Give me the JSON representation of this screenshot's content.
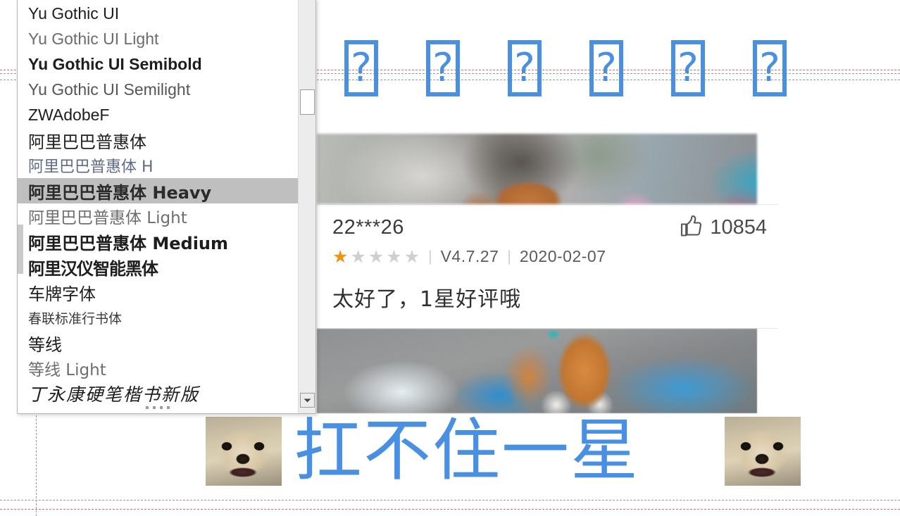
{
  "document": {
    "background_color": "#ffffff",
    "guides": {
      "red_dashed_color": "#e0654a",
      "gray_dashed_color": "#9a9a9a"
    }
  },
  "slide": {
    "tofu_row": {
      "glyph": "?",
      "count": 6,
      "color": "#4a90e2",
      "description": "missing-glyph-placeholder-boxes"
    },
    "big_text": "扛不住一星",
    "big_text_color": "#4a90e2",
    "memes": {
      "left_alt": "chihuahua-meme-face",
      "right_alt": "chihuahua-meme-face"
    },
    "review": {
      "photo_top_alt": "blurred-street-scene-with-cat-ears",
      "photo_bottom_alt": "orange-cat-sitting-on-blue-cloth-with-plastic-container",
      "reviewer": "22***26",
      "like_icon": "thumbs-up-icon",
      "like_count": "10854",
      "rating": 1,
      "rating_max": 5,
      "star_filled_color": "#f29211",
      "star_empty_color": "#cfcfcf",
      "version": "V4.7.27",
      "date": "2020-02-07",
      "separator": "|",
      "comment": "太好了，1星好评哦"
    }
  },
  "font_dropdown": {
    "selected": "阿里巴巴普惠体 Heavy",
    "scrollbar": {
      "down_arrow_icon": "chevron-down-icon"
    },
    "items": [
      {
        "label": "Yu Gothic UI",
        "style": "f-reg"
      },
      {
        "label": "Yu Gothic UI Light",
        "style": "f-light"
      },
      {
        "label": "Yu Gothic UI Semibold",
        "style": "f-semibold"
      },
      {
        "label": "Yu Gothic UI Semilight",
        "style": "f-semilight"
      },
      {
        "label": "ZWAdobeF",
        "style": "f-reg"
      },
      {
        "label": "阿里巴巴普惠体",
        "style": "f-cjk"
      },
      {
        "label": "阿里巴巴普惠体 H",
        "style": "f-cjk-thin"
      },
      {
        "label": "阿里巴巴普惠体 Heavy",
        "style": "f-cjk-heavy",
        "selected": true
      },
      {
        "label": "阿里巴巴普惠体 Light",
        "style": "f-cjk-light"
      },
      {
        "label": "阿里巴巴普惠体 Medium",
        "style": "f-cjk-med"
      },
      {
        "label": "阿里汉仪智能黑体",
        "style": "f-cjk-black"
      },
      {
        "label": "车牌字体",
        "style": "f-cjk-serif"
      },
      {
        "label": "春联标准行书体",
        "style": "f-cjk-small"
      },
      {
        "label": "等线",
        "style": "f-cjk"
      },
      {
        "label": "等线 Light",
        "style": "f-cjk-light"
      },
      {
        "label": "丁永康硬笔楷书新版",
        "style": "f-cjk-script"
      }
    ]
  }
}
